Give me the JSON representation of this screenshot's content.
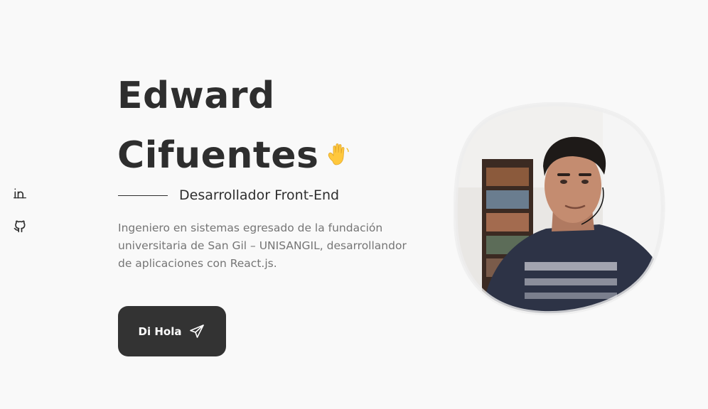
{
  "social": {
    "links": [
      {
        "name": "linkedin",
        "icon": "linkedin-icon"
      },
      {
        "name": "github",
        "icon": "github-icon"
      }
    ]
  },
  "hero": {
    "title_line1": "Edward",
    "title_line2": "Cifuentes",
    "wave_icon": "waving-hand-icon",
    "subtitle": "Desarrollador Front-End",
    "description": "Ingeniero en sistemas egresado de la fundación universitaria de San Gil – UNISANGIL, desarrollandor de aplicaciones con React.js.",
    "cta_label": "Di Hola",
    "cta_icon": "send-icon"
  },
  "colors": {
    "background": "#f9f9f9",
    "title": "#2e2e2e",
    "text_muted": "#757575",
    "button_bg": "#333333",
    "button_text": "#ffffff"
  }
}
